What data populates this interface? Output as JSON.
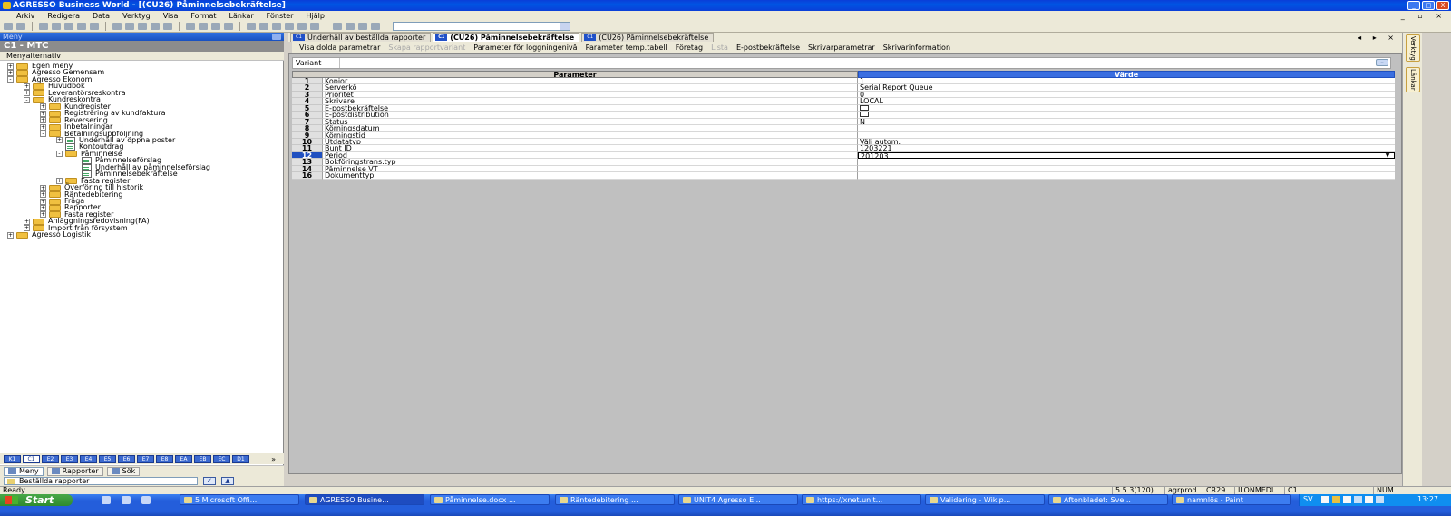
{
  "window": {
    "title": "AGRESSO Business World - [(CU26) Påminnelsebekräftelse]",
    "controls": [
      "_",
      "□",
      "X"
    ]
  },
  "menubar": {
    "items": [
      "Arkiv",
      "Redigera",
      "Data",
      "Verktyg",
      "Visa",
      "Format",
      "Länkar",
      "Fönster",
      "Hjälp"
    ]
  },
  "mdi_controls": "_ ▫ ×",
  "left_panel": {
    "header": "Meny",
    "company": "C1 - MTC",
    "subheader": "Menyalternativ",
    "tree": [
      {
        "label": "Egen meny",
        "level": 0,
        "expander": "+",
        "type": "folder"
      },
      {
        "label": "Agresso Gemensam",
        "level": 0,
        "expander": "+",
        "type": "folder"
      },
      {
        "label": "Agresso Ekonomi",
        "level": 0,
        "expander": "-",
        "type": "folder"
      },
      {
        "label": "Huvudbok",
        "level": 1,
        "expander": "+",
        "type": "folder"
      },
      {
        "label": "Leverantörsreskontra",
        "level": 1,
        "expander": "+",
        "type": "folder"
      },
      {
        "label": "Kundreskontra",
        "level": 1,
        "expander": "-",
        "type": "folder"
      },
      {
        "label": "Kundregister",
        "level": 2,
        "expander": "+",
        "type": "folder"
      },
      {
        "label": "Registrering av kundfaktura",
        "level": 2,
        "expander": "+",
        "type": "folder"
      },
      {
        "label": "Reversering",
        "level": 2,
        "expander": "+",
        "type": "folder"
      },
      {
        "label": "Inbetalningar",
        "level": 2,
        "expander": "+",
        "type": "folder"
      },
      {
        "label": "Betalningsuppföljning",
        "level": 2,
        "expander": "-",
        "type": "folder"
      },
      {
        "label": "Underhåll av öppna poster",
        "level": 3,
        "expander": "+",
        "type": "doc"
      },
      {
        "label": "Kontoutdrag",
        "level": 3,
        "expander": "",
        "type": "doc"
      },
      {
        "label": "Påminnelse",
        "level": 3,
        "expander": "-",
        "type": "folder"
      },
      {
        "label": "Påminnelseförslag",
        "level": 4,
        "expander": "",
        "type": "doc"
      },
      {
        "label": "Underhåll av påminnelseförslag",
        "level": 4,
        "expander": "",
        "type": "doc"
      },
      {
        "label": "Påminnelsebekräftelse",
        "level": 4,
        "expander": "",
        "type": "doc"
      },
      {
        "label": "Fasta register",
        "level": 3,
        "expander": "+",
        "type": "folder"
      },
      {
        "label": "Överföring till historik",
        "level": 2,
        "expander": "+",
        "type": "folder"
      },
      {
        "label": "Räntedebitering",
        "level": 2,
        "expander": "+",
        "type": "folder"
      },
      {
        "label": "Fråga",
        "level": 2,
        "expander": "+",
        "type": "folder"
      },
      {
        "label": "Rapporter",
        "level": 2,
        "expander": "+",
        "type": "folder"
      },
      {
        "label": "Fasta register",
        "level": 2,
        "expander": "+",
        "type": "folder"
      },
      {
        "label": "Anläggningsredovisning(FA)",
        "level": 1,
        "expander": "+",
        "type": "folder"
      },
      {
        "label": "Import från försystem",
        "level": 1,
        "expander": "+",
        "type": "folder"
      },
      {
        "label": "Agresso Logistik",
        "level": 0,
        "expander": "+",
        "type": "folder"
      }
    ],
    "company_tabs": [
      "K1",
      "C1",
      "E2",
      "E3",
      "E4",
      "E5",
      "E6",
      "E7",
      "E8",
      "EA",
      "EB",
      "EC",
      "D1"
    ],
    "active_company_tab": "C1",
    "nav_buttons": [
      "Meny",
      "Rapporter",
      "Sök"
    ],
    "bottom_input": "Beställda rapporter"
  },
  "doc_tabs": [
    {
      "badge": "C1",
      "label": "Underhåll av beställda rapporter",
      "active": false
    },
    {
      "badge": "C1",
      "label": "(CU26) Påminnelsebekräftelse",
      "active": true
    },
    {
      "badge": "C1",
      "label": "(CU26) Påminnelsebekräftelse",
      "active": false
    }
  ],
  "tab_controls": "◂ ▸ ×",
  "action_bar": [
    {
      "label": "Visa dolda parametrar",
      "enabled": true
    },
    {
      "label": "Skapa rapportvariant",
      "enabled": false
    },
    {
      "label": "Parameter för loggningenivå",
      "enabled": true
    },
    {
      "label": "Parameter temp.tabell",
      "enabled": true
    },
    {
      "label": "Företag",
      "enabled": true
    },
    {
      "label": "Lista",
      "enabled": false
    },
    {
      "label": "E-postbekräftelse",
      "enabled": true
    },
    {
      "label": "Skrivarparametrar",
      "enabled": true
    },
    {
      "label": "Skrivarinformation",
      "enabled": true
    }
  ],
  "variant": {
    "label": "Variant",
    "value": ""
  },
  "grid": {
    "headers": {
      "parameter": "Parameter",
      "value": "Värde"
    },
    "rows": [
      {
        "n": "1",
        "param": "Kopior",
        "value": "1",
        "kind": "text"
      },
      {
        "n": "2",
        "param": "Serverkö",
        "value": "Serial Report Queue",
        "kind": "text"
      },
      {
        "n": "3",
        "param": "Prioritet",
        "value": "0",
        "kind": "text"
      },
      {
        "n": "4",
        "param": "Skrivare",
        "value": "LOCAL",
        "kind": "text"
      },
      {
        "n": "5",
        "param": "E-postbekräftelse",
        "value": "",
        "kind": "checkbox"
      },
      {
        "n": "6",
        "param": "E-postdistribution",
        "value": "",
        "kind": "checkbox"
      },
      {
        "n": "7",
        "param": "Status",
        "value": "N",
        "kind": "text"
      },
      {
        "n": "8",
        "param": "Körningsdatum",
        "value": "",
        "kind": "text"
      },
      {
        "n": "9",
        "param": "Körningstid",
        "value": "",
        "kind": "text"
      },
      {
        "n": "10",
        "param": "Utdatatyp",
        "value": "Välj autom.",
        "kind": "text"
      },
      {
        "n": "11",
        "param": "Bunt ID",
        "value": "1203221",
        "kind": "text"
      },
      {
        "n": "12",
        "param": "Period",
        "value": "201203",
        "kind": "dropdown",
        "selected": true
      },
      {
        "n": "13",
        "param": "Bokföringstrans.typ",
        "value": "",
        "kind": "text"
      },
      {
        "n": "14",
        "param": "Påminnelse VT",
        "value": "",
        "kind": "text"
      },
      {
        "n": "16",
        "param": "Dokumenttyp",
        "value": "",
        "kind": "text"
      }
    ]
  },
  "right_tabs": [
    "Verktyg",
    "Länkar"
  ],
  "statusbar": {
    "left": "Ready",
    "fields": [
      "5.5.3(120)",
      "agrprod",
      "CR29",
      "ILONMEDI",
      "C1",
      "NUM"
    ]
  },
  "taskbar": {
    "start": "Start",
    "tasks": [
      {
        "label": "5 Microsoft Offi...",
        "active": false
      },
      {
        "label": "AGRESSO Busine...",
        "active": true
      },
      {
        "label": "Påminnelse.docx ...",
        "active": false
      },
      {
        "label": "Räntedebitering ...",
        "active": false
      },
      {
        "label": "UNIT4 Agresso E...",
        "active": false
      },
      {
        "label": "https://xnet.unit...",
        "active": false
      },
      {
        "label": "Validering - Wikip...",
        "active": false
      },
      {
        "label": "Aftonbladet: Sve...",
        "active": false
      },
      {
        "label": "namnlös - Paint",
        "active": false
      }
    ],
    "tray_lang": "SV",
    "clock": "13:27"
  },
  "colors": {
    "title_blue": "#0054e3",
    "value_header_blue": "#3a6ee0",
    "folder_yellow": "#f0c040",
    "taskbar_blue": "#245edb"
  }
}
